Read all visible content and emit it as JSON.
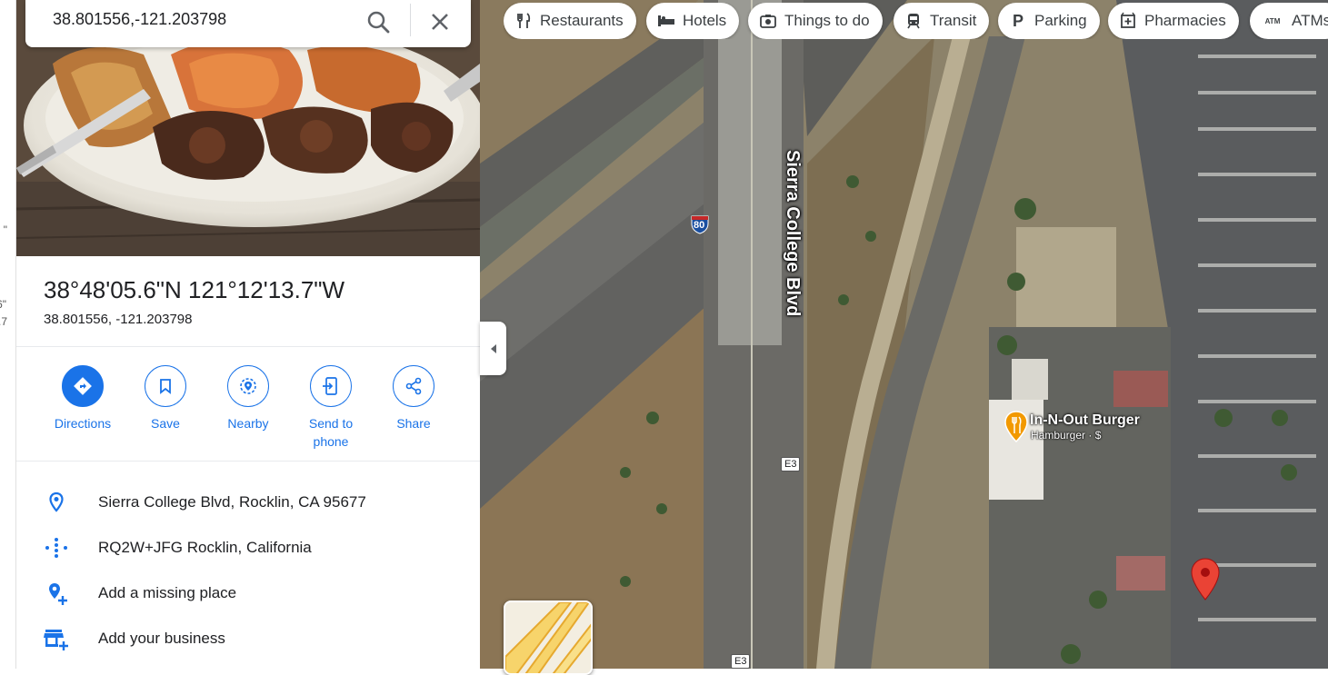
{
  "search": {
    "value": "38.801556,-121.203798",
    "search_icon": "search-icon",
    "close_icon": "close-icon"
  },
  "left_strip": {
    "fragments": [
      "\"",
      "6\"",
      ".7"
    ]
  },
  "place": {
    "title": "38°48'05.6\"N 121°12'13.7\"W",
    "decimal": "38.801556, -121.203798"
  },
  "actions": [
    {
      "label": "Directions",
      "icon": "directions-icon"
    },
    {
      "label": "Save",
      "icon": "bookmark-icon"
    },
    {
      "label": "Nearby",
      "icon": "nearby-icon"
    },
    {
      "label": "Send to phone",
      "icon": "send-to-phone-icon"
    },
    {
      "label": "Share",
      "icon": "share-icon"
    }
  ],
  "info": [
    {
      "text": "Sierra College Blvd, Rocklin, CA 95677",
      "icon": "location-pin-icon"
    },
    {
      "text": "RQ2W+JFG Rocklin, California",
      "icon": "plus-code-icon"
    },
    {
      "text": "Add a missing place",
      "icon": "add-place-icon"
    },
    {
      "text": "Add your business",
      "icon": "add-business-icon"
    }
  ],
  "chips": [
    {
      "label": "Restaurants",
      "icon": "fork-knife-icon"
    },
    {
      "label": "Hotels",
      "icon": "bed-icon"
    },
    {
      "label": "Things to do",
      "icon": "camera-icon"
    },
    {
      "label": "Transit",
      "icon": "train-icon"
    },
    {
      "label": "Parking",
      "icon": "parking-icon"
    },
    {
      "label": "Pharmacies",
      "icon": "pharmacy-icon"
    },
    {
      "label": "ATMs",
      "icon": "atm-icon",
      "icon_text": "ATM"
    }
  ],
  "map": {
    "road_label": "Sierra College Blvd",
    "interstate": "80",
    "county_route": "E3",
    "poi": {
      "name": "In-N-Out Burger",
      "subtitle": "Hamburger · $"
    },
    "colors": {
      "accent": "#1a73e8",
      "pin": "#ea4335",
      "poi": "#f29900"
    }
  }
}
